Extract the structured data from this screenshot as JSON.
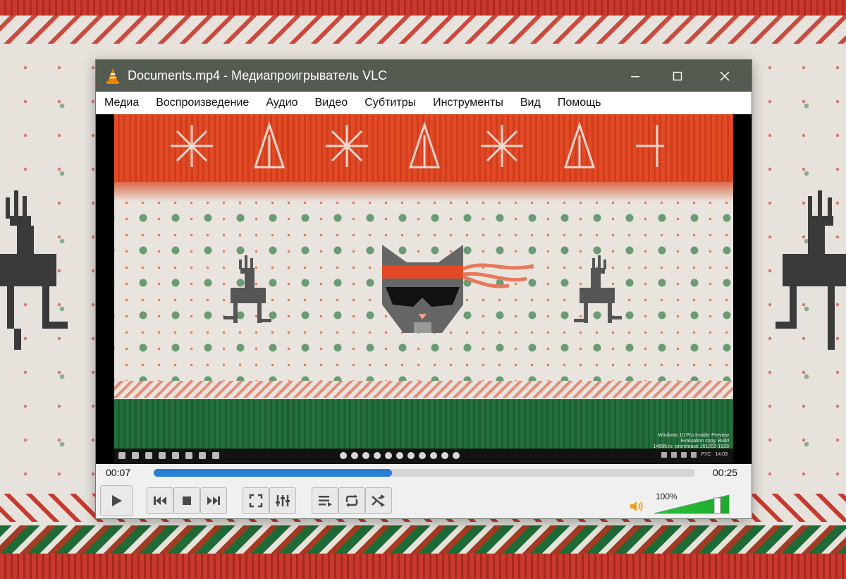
{
  "window": {
    "title": "Documents.mp4 - Медиапроигрыватель VLC",
    "app_icon": "vlc-cone-icon",
    "buttons": [
      "minimize-icon",
      "maximize-icon",
      "close-icon"
    ]
  },
  "menu": {
    "items": [
      "Медиа",
      "Воспроизведение",
      "Аудио",
      "Видео",
      "Субтитры",
      "Инструменты",
      "Вид",
      "Помощь"
    ]
  },
  "playback": {
    "elapsed": "00:07",
    "total": "00:25",
    "progress_fraction": 0.44
  },
  "controls": {
    "icons": [
      "play-icon",
      "previous-icon",
      "stop-icon",
      "next-icon",
      "fullscreen-icon",
      "extended-settings-icon",
      "playlist-icon",
      "loop-icon",
      "shuffle-icon",
      "speaker-icon"
    ]
  },
  "volume": {
    "label": "100%",
    "level_fraction": 1.0
  },
  "video": {
    "watermark_line1": "Windows 10 Pro Insider Preview",
    "watermark_line2": "Evaluation copy. Build 14986.rs_prerelease.161202-1928",
    "taskbar_lang": "РУС",
    "taskbar_time": "14:09"
  },
  "colors": {
    "titlebar": "#545b51",
    "seek_fill": "#2a7fd4",
    "volume_fill": "#2bc23a",
    "vlc_orange": "#f08200"
  }
}
